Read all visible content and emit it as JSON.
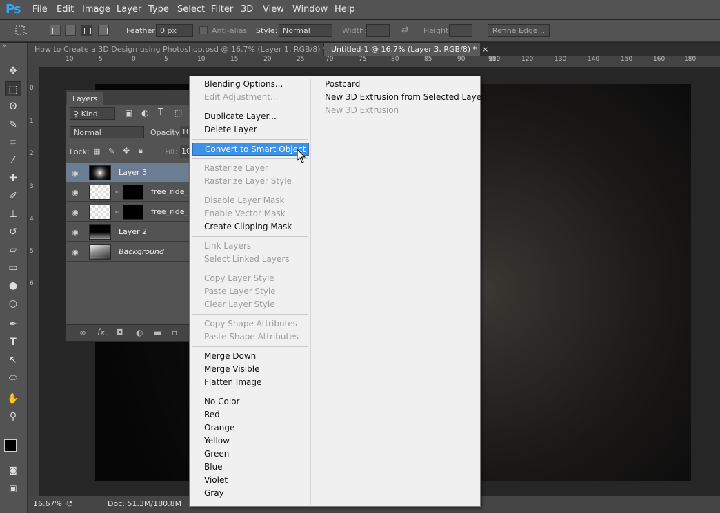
{
  "app": {
    "logo": "Ps"
  },
  "menubar": {
    "items": [
      "File",
      "Edit",
      "Image",
      "Layer",
      "Type",
      "Select",
      "Filter",
      "3D",
      "View",
      "Window",
      "Help"
    ]
  },
  "options": {
    "feather_label": "Feather:",
    "feather_value": "0 px",
    "antialias_label": "Anti-alias",
    "style_label": "Style:",
    "style_value": "Normal",
    "width_label": "Width:",
    "height_label": "Height:",
    "refine_edge": "Refine Edge..."
  },
  "tabs": [
    {
      "title": "How to Create a 3D Design using Photoshop.psd @ 16.7% (Layer 1, RGB/8) *",
      "close": "×",
      "active": false
    },
    {
      "title": "Untitled-1 @ 16.7% (Layer 3, RGB/8) *",
      "close": "×",
      "active": true
    }
  ],
  "ruler": {
    "h_ticks": [
      "10",
      "5",
      "0",
      "5",
      "10",
      "15",
      "20",
      "25",
      "30",
      "35",
      "70",
      "75",
      "80",
      "85",
      "90",
      "95",
      "100",
      "110",
      "120",
      "130",
      "140",
      "150",
      "160",
      "170",
      "180"
    ],
    "v_ticks": [
      "0",
      "1",
      "2",
      "3",
      "4",
      "5",
      "6"
    ]
  },
  "layers_panel": {
    "title": "Layers",
    "kind": "Kind",
    "blend_mode": "Normal",
    "opacity_label": "Opacity:",
    "opacity_value": "10",
    "lock_label": "Lock:",
    "fill_label": "Fill:",
    "fill_value": "10",
    "layers": [
      {
        "name": "Layer 3",
        "selected": true
      },
      {
        "name": "free_ride_by",
        "selected": false
      },
      {
        "name": "free_ride_by",
        "selected": false
      },
      {
        "name": "Layer 2",
        "selected": false
      },
      {
        "name": "Background",
        "selected": false
      }
    ]
  },
  "context_menu": {
    "items": [
      {
        "label": "Blending Options...",
        "disabled": false
      },
      {
        "label": "Edit Adjustment...",
        "disabled": true
      },
      {
        "label": "Duplicate Layer...",
        "disabled": false
      },
      {
        "label": "Delete Layer",
        "disabled": false
      },
      {
        "label": "Convert to Smart Object",
        "disabled": false,
        "highlighted": true
      },
      {
        "label": "Rasterize Layer",
        "disabled": true
      },
      {
        "label": "Rasterize Layer Style",
        "disabled": true
      },
      {
        "label": "Disable Layer Mask",
        "disabled": true
      },
      {
        "label": "Enable Vector Mask",
        "disabled": true
      },
      {
        "label": "Create Clipping Mask",
        "disabled": false
      },
      {
        "label": "Link Layers",
        "disabled": true
      },
      {
        "label": "Select Linked Layers",
        "disabled": true
      },
      {
        "label": "Copy Layer Style",
        "disabled": true
      },
      {
        "label": "Paste Layer Style",
        "disabled": true
      },
      {
        "label": "Clear Layer Style",
        "disabled": true
      },
      {
        "label": "Copy Shape Attributes",
        "disabled": true
      },
      {
        "label": "Paste Shape Attributes",
        "disabled": true
      },
      {
        "label": "Merge Down",
        "disabled": false
      },
      {
        "label": "Merge Visible",
        "disabled": false
      },
      {
        "label": "Flatten Image",
        "disabled": false
      },
      {
        "label": "No Color",
        "disabled": false
      },
      {
        "label": "Red",
        "disabled": false
      },
      {
        "label": "Orange",
        "disabled": false
      },
      {
        "label": "Yellow",
        "disabled": false
      },
      {
        "label": "Green",
        "disabled": false
      },
      {
        "label": "Blue",
        "disabled": false
      },
      {
        "label": "Violet",
        "disabled": false
      },
      {
        "label": "Gray",
        "disabled": false
      }
    ],
    "submenu": [
      {
        "label": "Postcard",
        "disabled": false
      },
      {
        "label": "New 3D Extrusion from Selected Layer",
        "disabled": false
      },
      {
        "label": "New 3D Extrusion",
        "disabled": true
      }
    ]
  },
  "status": {
    "zoom": "16.67%",
    "doc": "Doc: 51.3M/180.8M"
  },
  "colors": {
    "accent": "#3e92e6",
    "ps_blue": "#31a8ff",
    "selected_layer": "#6b7d91"
  },
  "toolbar_icons": [
    "move-icon",
    "marquee-icon",
    "lasso-icon",
    "quick-select-icon",
    "crop-icon",
    "eyedropper-icon",
    "healing-brush-icon",
    "brush-icon",
    "clone-stamp-icon",
    "history-brush-icon",
    "eraser-icon",
    "gradient-icon",
    "blur-icon",
    "dodge-icon",
    "pen-icon",
    "type-icon",
    "path-select-icon",
    "ellipse-icon",
    "hand-icon",
    "zoom-icon"
  ]
}
